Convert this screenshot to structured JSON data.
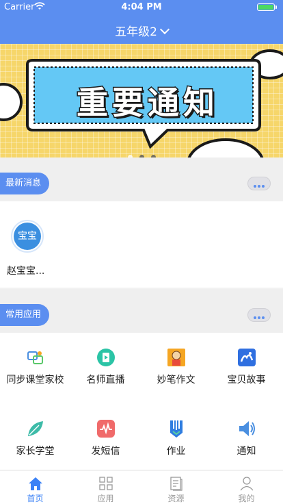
{
  "status_bar": {
    "carrier": "Carrier",
    "time": "4:04 PM",
    "battery_level": 1.0
  },
  "nav": {
    "title": "五年级2"
  },
  "banner": {
    "text": "重要通知",
    "slides": 3,
    "active_slide": 0
  },
  "news_section": {
    "label": "最新消息"
  },
  "messages": [
    {
      "avatar_text": "宝宝",
      "name": "赵宝宝..."
    }
  ],
  "apps_section": {
    "label": "常用应用"
  },
  "apps": [
    {
      "label": "同步课堂家校",
      "icon": "sync-class-icon"
    },
    {
      "label": "名师直播",
      "icon": "live-teacher-icon"
    },
    {
      "label": "妙笔作文",
      "icon": "composition-icon"
    },
    {
      "label": "宝贝故事",
      "icon": "story-icon"
    },
    {
      "label": "家长学堂",
      "icon": "parent-school-icon"
    },
    {
      "label": "发短信",
      "icon": "sms-icon"
    },
    {
      "label": "作业",
      "icon": "homework-icon"
    },
    {
      "label": "通知",
      "icon": "notice-icon"
    }
  ],
  "tabs": [
    {
      "label": "首页",
      "icon": "home-icon",
      "active": true
    },
    {
      "label": "应用",
      "icon": "apps-icon",
      "active": false
    },
    {
      "label": "资源",
      "icon": "resources-icon",
      "active": false
    },
    {
      "label": "我的",
      "icon": "profile-icon",
      "active": false
    }
  ],
  "colors": {
    "primary": "#5b8ef0",
    "active_tab": "#3b82f6",
    "banner_bg": "#f6d66a"
  }
}
